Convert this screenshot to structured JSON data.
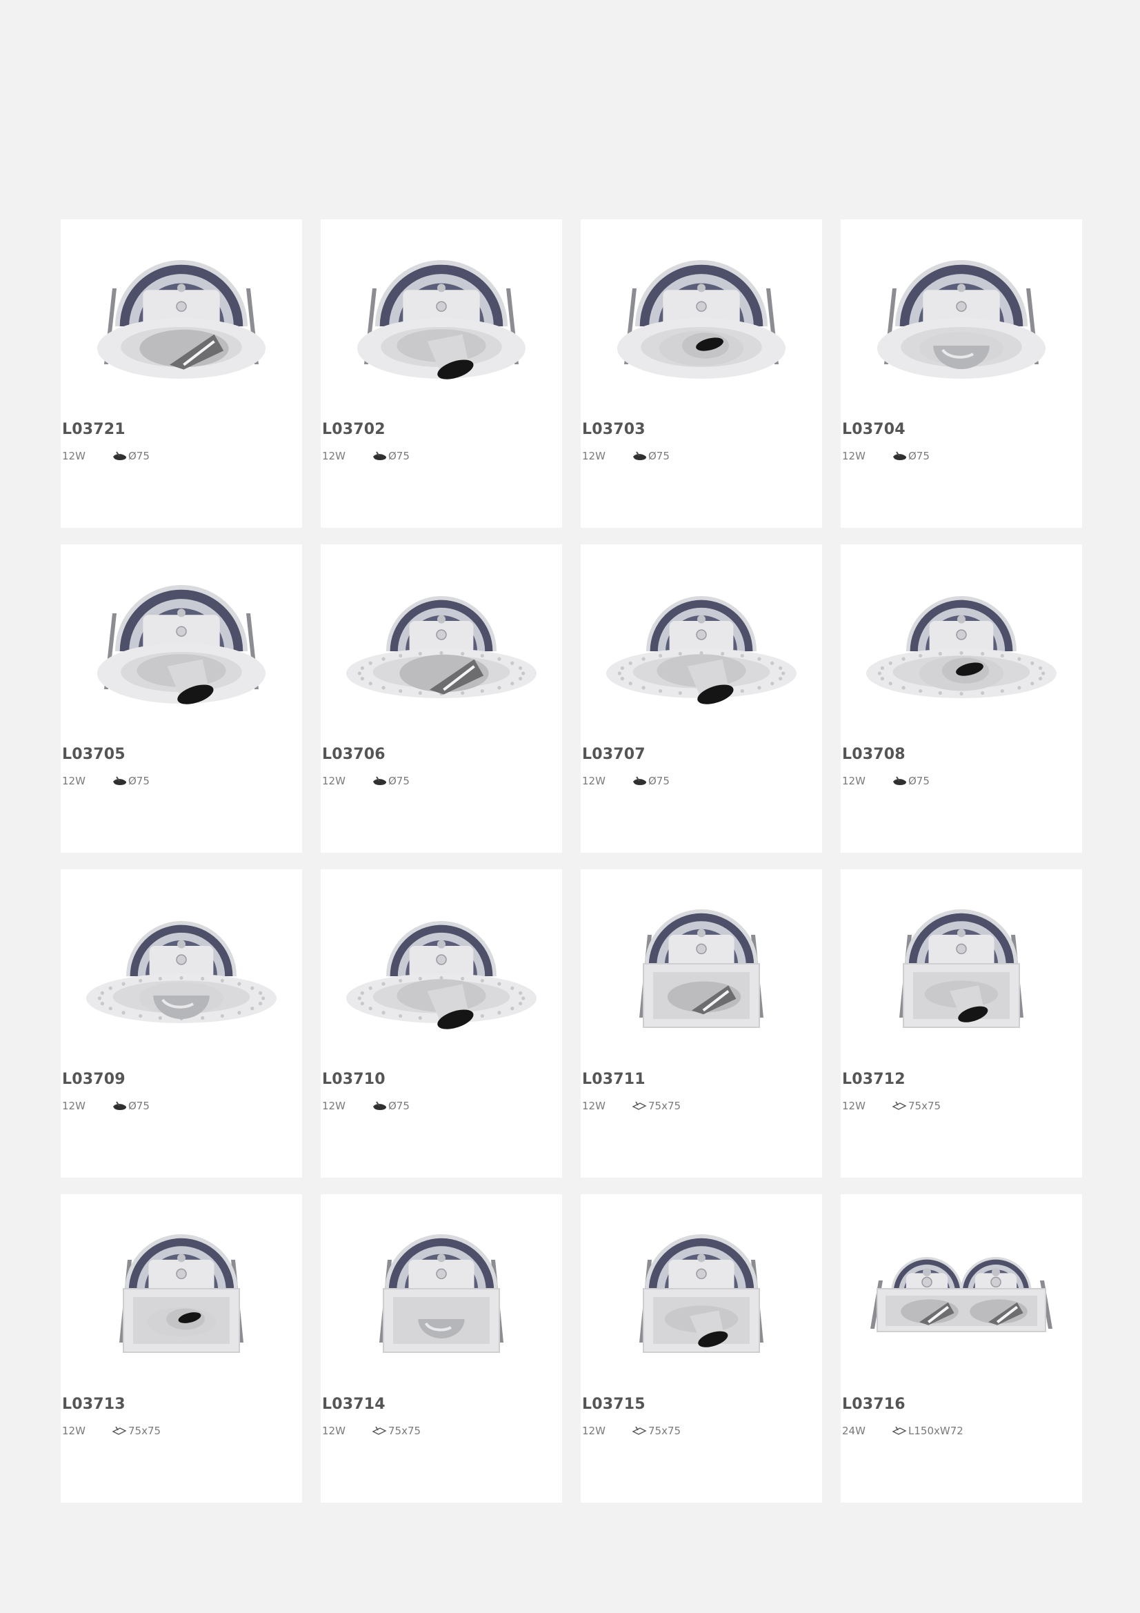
{
  "colors": {
    "page_bg": "#f2f2f2",
    "card_bg": "#ffffff",
    "code_text": "#555555",
    "spec_text": "#7a7a7a"
  },
  "products": [
    {
      "code": "L03721",
      "power": "12W",
      "cutout": "Ø75",
      "housing": "round",
      "frame": "clips",
      "lens": "reflector"
    },
    {
      "code": "L03702",
      "power": "12W",
      "cutout": "Ø75",
      "housing": "round",
      "frame": "clips",
      "lens": "snoot"
    },
    {
      "code": "L03703",
      "power": "12W",
      "cutout": "Ø75",
      "housing": "round",
      "frame": "clips",
      "lens": "eyeball"
    },
    {
      "code": "L03704",
      "power": "12W",
      "cutout": "Ø75",
      "housing": "round",
      "frame": "clips",
      "lens": "dome"
    },
    {
      "code": "L03705",
      "power": "12W",
      "cutout": "Ø75",
      "housing": "round",
      "frame": "clips",
      "lens": "snoot"
    },
    {
      "code": "L03706",
      "power": "12W",
      "cutout": "Ø75",
      "housing": "round",
      "frame": "trimless",
      "lens": "reflector"
    },
    {
      "code": "L03707",
      "power": "12W",
      "cutout": "Ø75",
      "housing": "round",
      "frame": "trimless",
      "lens": "snoot"
    },
    {
      "code": "L03708",
      "power": "12W",
      "cutout": "Ø75",
      "housing": "round",
      "frame": "trimless",
      "lens": "eyeball"
    },
    {
      "code": "L03709",
      "power": "12W",
      "cutout": "Ø75",
      "housing": "round",
      "frame": "trimless",
      "lens": "dome"
    },
    {
      "code": "L03710",
      "power": "12W",
      "cutout": "Ø75",
      "housing": "round",
      "frame": "trimless",
      "lens": "snoot"
    },
    {
      "code": "L03711",
      "power": "12W",
      "cutout": "75x75",
      "housing": "square",
      "frame": "clips",
      "lens": "reflector"
    },
    {
      "code": "L03712",
      "power": "12W",
      "cutout": "75x75",
      "housing": "square",
      "frame": "clips",
      "lens": "snoot"
    },
    {
      "code": "L03713",
      "power": "12W",
      "cutout": "75x75",
      "housing": "square",
      "frame": "clips",
      "lens": "eyeball"
    },
    {
      "code": "L03714",
      "power": "12W",
      "cutout": "75x75",
      "housing": "square",
      "frame": "clips",
      "lens": "dome"
    },
    {
      "code": "L03715",
      "power": "12W",
      "cutout": "75x75",
      "housing": "square",
      "frame": "clips",
      "lens": "snoot"
    },
    {
      "code": "L03716",
      "power": "24W",
      "cutout": "L150xW72",
      "housing": "double",
      "frame": "clips",
      "lens": "reflector"
    }
  ]
}
